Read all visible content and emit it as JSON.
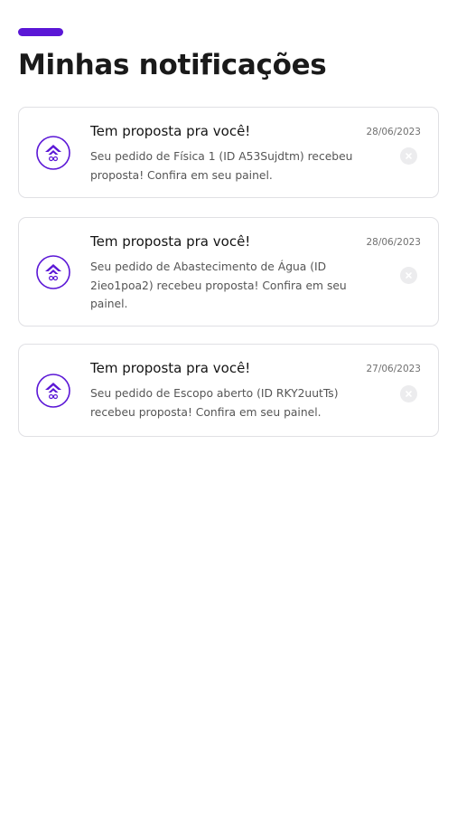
{
  "page": {
    "title": "Minhas notificações",
    "accent_color": "#5b17d6"
  },
  "notifications": [
    {
      "title": "Tem proposta pra você!",
      "date": "28/06/2023",
      "message": "Seu pedido de Física 1 (ID A53Sujdtm) recebeu proposta! Confira em seu painel.",
      "icon": "brand-logo-icon",
      "dismiss_icon": "close-icon"
    },
    {
      "title": "Tem proposta pra você!",
      "date": "28/06/2023",
      "message": "Seu pedido de Abastecimento de Água (ID 2ieo1poa2) recebeu proposta! Confira em seu painel.",
      "icon": "brand-logo-icon",
      "dismiss_icon": "close-icon"
    },
    {
      "title": "Tem proposta pra você!",
      "date": "27/06/2023",
      "message": "Seu pedido de Escopo aberto (ID RKY2uutTs) recebeu proposta! Confira em seu painel.",
      "icon": "brand-logo-icon",
      "dismiss_icon": "close-icon"
    }
  ]
}
